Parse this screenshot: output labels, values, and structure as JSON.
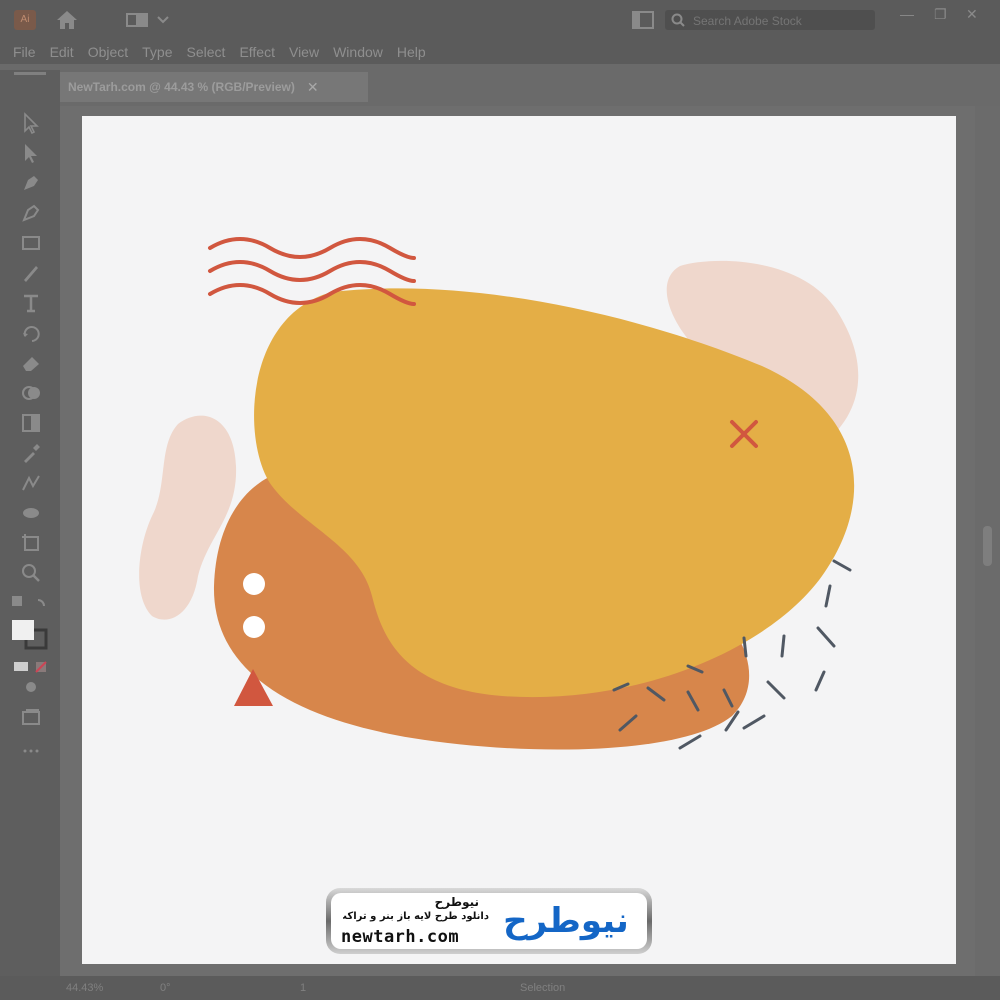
{
  "app": {
    "logo_text": "Ai"
  },
  "menu": [
    "File",
    "Edit",
    "Object",
    "Type",
    "Select",
    "Effect",
    "View",
    "Window",
    "Help"
  ],
  "search": {
    "placeholder": "Search Adobe Stock"
  },
  "window_controls": {
    "minimize": "—",
    "restore": "❐",
    "close": "✕"
  },
  "document_tab": {
    "title": "NewTarh.com @ 44.43 % (RGB/Preview)",
    "close": "✕"
  },
  "status": {
    "zoom": "44.43%",
    "rotate": "0°",
    "artboard": "1",
    "tool": "Selection"
  },
  "colors": {
    "mustard": "#e4ae46",
    "orange": "#d7864b",
    "blush": "#efd7cc",
    "red": "#d1573f",
    "dash": "#505863",
    "white": "#ffffff"
  },
  "watermark": {
    "brand_fa": "نیوطرح",
    "tagline_fa": "دانلود طرح لایه باز بنر و تراکت",
    "url": "newtarh.com",
    "logo_glyphs": "نیوطرح"
  }
}
